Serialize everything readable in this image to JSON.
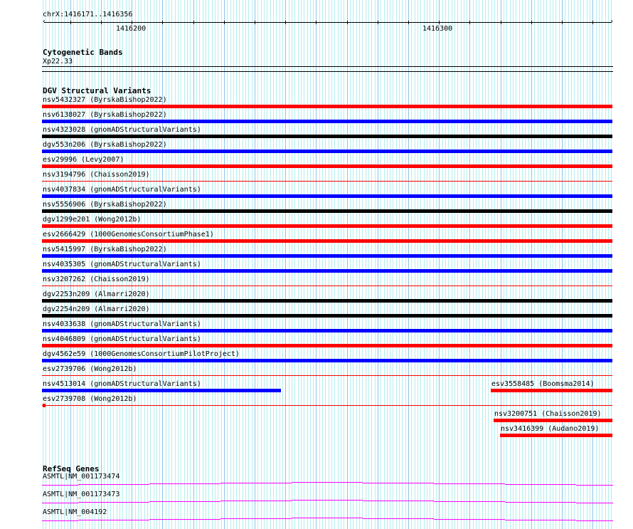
{
  "ruler": {
    "location": "chrX:1416171..1416356",
    "start": 1416171,
    "end": 1416356,
    "labels": [
      "1416200",
      "1416300"
    ]
  },
  "cytoband": {
    "title": "Cytogenetic Bands",
    "band": "Xp22.33"
  },
  "dgv": {
    "title": "DGV Structural Variants",
    "colors": {
      "red": "#ff0000",
      "blue": "#0000ff",
      "black": "#000000"
    },
    "features": [
      {
        "lane": 0,
        "label": "nsv5432327 (ByrskaBishop2022)",
        "color": "red",
        "style": "thick",
        "start": 1416171,
        "end": 1416356
      },
      {
        "lane": 1,
        "label": "nsv6138027 (ByrskaBishop2022)",
        "color": "blue",
        "style": "thick",
        "start": 1416171,
        "end": 1416356
      },
      {
        "lane": 2,
        "label": "nsv4323028 (gnomADStructuralVariants)",
        "color": "black",
        "style": "thick",
        "start": 1416171,
        "end": 1416356
      },
      {
        "lane": 3,
        "label": "dgv553n206 (ByrskaBishop2022)",
        "color": "blue",
        "style": "thick",
        "start": 1416171,
        "end": 1416356
      },
      {
        "lane": 4,
        "label": "esv29996 (Levy2007)",
        "color": "red",
        "style": "thick",
        "start": 1416171,
        "end": 1416356
      },
      {
        "lane": 5,
        "label": "nsv3194796 (Chaisson2019)",
        "color": "red",
        "style": "thin",
        "start": 1416171,
        "end": 1416356
      },
      {
        "lane": 6,
        "label": "nsv4037834 (gnomADStructuralVariants)",
        "color": "blue",
        "style": "thick",
        "start": 1416171,
        "end": 1416356
      },
      {
        "lane": 7,
        "label": "nsv5556906 (ByrskaBishop2022)",
        "color": "black",
        "style": "thick",
        "start": 1416171,
        "end": 1416356
      },
      {
        "lane": 8,
        "label": "dgv1299e201 (Wong2012b)",
        "color": "red",
        "style": "thick",
        "start": 1416171,
        "end": 1416356
      },
      {
        "lane": 9,
        "label": "esv2666429 (1000GenomesConsortiumPhase1)",
        "color": "red",
        "style": "thick",
        "start": 1416171,
        "end": 1416356
      },
      {
        "lane": 10,
        "label": "nsv5415997 (ByrskaBishop2022)",
        "color": "blue",
        "style": "thick",
        "start": 1416171,
        "end": 1416356
      },
      {
        "lane": 11,
        "label": "nsv4035305 (gnomADStructuralVariants)",
        "color": "blue",
        "style": "thick",
        "start": 1416171,
        "end": 1416356
      },
      {
        "lane": 12,
        "label": "nsv3207262 (Chaisson2019)",
        "color": "red",
        "style": "thin",
        "start": 1416171,
        "end": 1416356
      },
      {
        "lane": 13,
        "label": "dgv2253n209 (Almarri2020)",
        "color": "black",
        "style": "thick",
        "start": 1416171,
        "end": 1416356
      },
      {
        "lane": 14,
        "label": "dgv2254n209 (Almarri2020)",
        "color": "black",
        "style": "thick",
        "start": 1416171,
        "end": 1416356
      },
      {
        "lane": 15,
        "label": "nsv4033638 (gnomADStructuralVariants)",
        "color": "blue",
        "style": "thick",
        "start": 1416171,
        "end": 1416356
      },
      {
        "lane": 16,
        "label": "nsv4046809 (gnomADStructuralVariants)",
        "color": "red",
        "style": "thick",
        "start": 1416171,
        "end": 1416356
      },
      {
        "lane": 17,
        "label": "dgv4562e59 (1000GenomesConsortiumPilotProject)",
        "color": "blue",
        "style": "thick",
        "start": 1416171,
        "end": 1416356
      },
      {
        "lane": 18,
        "label": "esv2739706 (Wong2012b)",
        "color": "red",
        "style": "thin",
        "start": 1416171,
        "end": 1416356
      },
      {
        "lane": 19,
        "label": "nsv4513014 (gnomADStructuralVariants)",
        "color": "blue",
        "style": "thick",
        "start": 1416171,
        "end": 1416248
      },
      {
        "lane": 19,
        "label": "esv3558485 (Boomsma2014)",
        "color": "red",
        "style": "thick",
        "start": 1416317,
        "end": 1416356
      },
      {
        "lane": 20,
        "label": "esv2739708 (Wong2012b)",
        "color": "red",
        "style": "thinbox",
        "start": 1416171,
        "end": 1416356
      },
      {
        "lane": 21,
        "label": "nsv3200751 (Chaisson2019)",
        "color": "red",
        "style": "thick",
        "start": 1416318,
        "end": 1416356
      },
      {
        "lane": 22,
        "label": "nsv3416399 (Audano2019)",
        "color": "red",
        "style": "thick",
        "start": 1416320,
        "end": 1416356
      }
    ]
  },
  "refseq": {
    "title": "RefSeq Genes",
    "color": "#ff00ff",
    "genes": [
      "ASMTL|NM_001173474",
      "ASMTL|NM_001173473",
      "ASMTL|NM_004192"
    ]
  }
}
